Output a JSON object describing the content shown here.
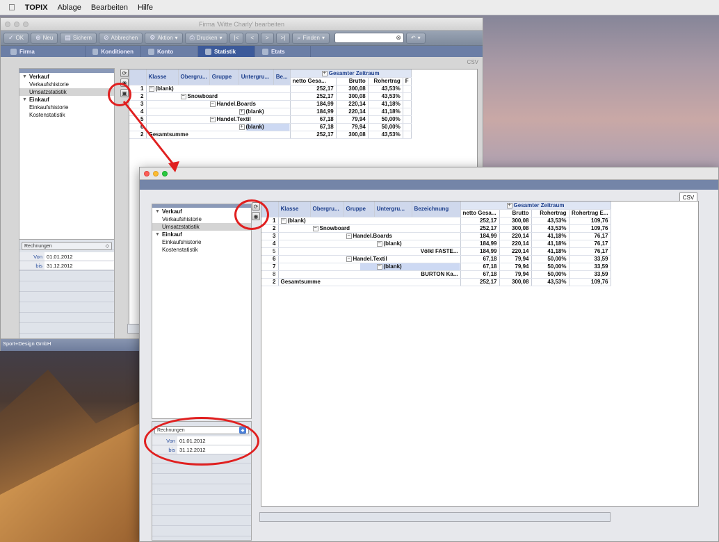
{
  "menubar": {
    "apple": "",
    "app": "TOPIX",
    "items": [
      "Ablage",
      "Bearbeiten",
      "Hilfe"
    ]
  },
  "back_window": {
    "title": "Firma 'Witte Charly' bearbeiten",
    "toolbar": {
      "ok": "OK",
      "neu": "Neu",
      "sichern": "Sichern",
      "abbrechen": "Abbrechen",
      "aktion": "Aktion",
      "drucken": "Drucken",
      "finden": "Finden"
    },
    "tabs": [
      "Firma",
      "Konditionen",
      "Konto",
      "Statistik",
      "Etats"
    ],
    "active_tab": "Statistik",
    "csv": "CSV",
    "company": "Sport+Design GmbH"
  },
  "tree": [
    {
      "label": "Verkauf",
      "type": "parent"
    },
    {
      "label": "Verkaufshistorie",
      "type": "child"
    },
    {
      "label": "Umsatzstatistik",
      "type": "child",
      "selected": true
    },
    {
      "label": "Einkauf",
      "type": "parent"
    },
    {
      "label": "Einkaufshistorie",
      "type": "child"
    },
    {
      "label": "Kostenstatistik",
      "type": "child"
    }
  ],
  "filter": {
    "source": "Rechnungen",
    "von_label": "Von",
    "von": "01.01.2012",
    "bis_label": "bis",
    "bis": "31.12.2012"
  },
  "grid": {
    "group_header": "Gesamter Zeitraum",
    "dims_back": [
      "Klasse",
      "Obergru...",
      "Gruppe",
      "Untergru...",
      "Be..."
    ],
    "dims_front": [
      "Klasse",
      "Obergru...",
      "Gruppe",
      "Untergru...",
      "Bezeichnung"
    ],
    "measures_back": [
      "netto Gesa...",
      "Brutto",
      "Rohertrag",
      "F"
    ],
    "measures_front": [
      "netto Gesa...",
      "Brutto",
      "Rohertrag",
      "Rohertrag E..."
    ],
    "rows_back": [
      {
        "n": "1",
        "lvl": 0,
        "label": "(blank)",
        "sign": "−",
        "v": [
          "252,17",
          "300,08",
          "43,53%"
        ]
      },
      {
        "n": "2",
        "lvl": 1,
        "label": "Snowboard",
        "sign": "−",
        "v": [
          "252,17",
          "300,08",
          "43,53%"
        ]
      },
      {
        "n": "3",
        "lvl": 2,
        "label": "Handel.Boards",
        "sign": "−",
        "v": [
          "184,99",
          "220,14",
          "41,18%"
        ]
      },
      {
        "n": "4",
        "lvl": 3,
        "label": "(blank)",
        "sign": "+",
        "v": [
          "184,99",
          "220,14",
          "41,18%"
        ]
      },
      {
        "n": "5",
        "lvl": 2,
        "label": "Handel.Textil",
        "sign": "−",
        "v": [
          "67,18",
          "79,94",
          "50,00%"
        ]
      },
      {
        "n": "6",
        "lvl": 3,
        "label": "(blank)",
        "sign": "+",
        "v": [
          "67,18",
          "79,94",
          "50,00%"
        ]
      },
      {
        "n": "2",
        "lvl": -1,
        "label": "Gesamtsumme",
        "sign": "",
        "v": [
          "252,17",
          "300,08",
          "43,53%"
        ]
      }
    ],
    "rows_front": [
      {
        "n": "1",
        "lvl": 0,
        "label": "(blank)",
        "sign": "−",
        "v": [
          "252,17",
          "300,08",
          "43,53%",
          "109,76"
        ]
      },
      {
        "n": "2",
        "lvl": 1,
        "label": "Snowboard",
        "sign": "−",
        "v": [
          "252,17",
          "300,08",
          "43,53%",
          "109,76"
        ]
      },
      {
        "n": "3",
        "lvl": 2,
        "label": "Handel.Boards",
        "sign": "−",
        "v": [
          "184,99",
          "220,14",
          "41,18%",
          "76,17"
        ]
      },
      {
        "n": "4",
        "lvl": 3,
        "label": "(blank)",
        "sign": "−",
        "v": [
          "184,99",
          "220,14",
          "41,18%",
          "76,17"
        ]
      },
      {
        "n": "5",
        "lvl": 4,
        "label": "Völkl FASTE...",
        "sign": "",
        "v": [
          "184,99",
          "220,14",
          "41,18%",
          "76,17"
        ]
      },
      {
        "n": "6",
        "lvl": 2,
        "label": "Handel.Textil",
        "sign": "−",
        "v": [
          "67,18",
          "79,94",
          "50,00%",
          "33,59"
        ]
      },
      {
        "n": "7",
        "lvl": 3,
        "label": "(blank)",
        "sign": "−",
        "v": [
          "67,18",
          "79,94",
          "50,00%",
          "33,59"
        ]
      },
      {
        "n": "8",
        "lvl": 4,
        "label": "BURTON Ka...",
        "sign": "",
        "v": [
          "67,18",
          "79,94",
          "50,00%",
          "33,59"
        ]
      },
      {
        "n": "2",
        "lvl": -1,
        "label": "Gesamtsumme",
        "sign": "",
        "v": [
          "252,17",
          "300,08",
          "43,53%",
          "109,76"
        ]
      }
    ]
  }
}
